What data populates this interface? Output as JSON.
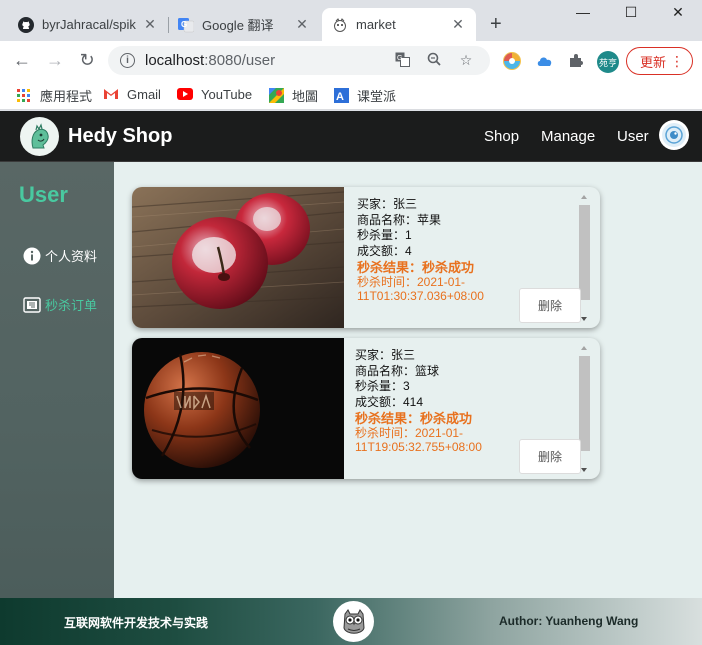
{
  "browser": {
    "tabs": [
      {
        "title": "byrJahracal/spik",
        "icon": "github-icon"
      },
      {
        "title": "Google 翻译",
        "icon": "google-translate-icon"
      },
      {
        "title": "market",
        "icon": "market-favicon-icon"
      }
    ],
    "new_tab": "+",
    "url_host": "localhost",
    "url_path": ":8080/user",
    "update_label": "更新",
    "profile_label": "苑亨",
    "bookmarks": [
      {
        "label": "應用程式",
        "icon": "apps-grid-icon"
      },
      {
        "label": "Gmail",
        "icon": "gmail-icon"
      },
      {
        "label": "YouTube",
        "icon": "youtube-icon"
      },
      {
        "label": "地圖",
        "icon": "maps-icon"
      },
      {
        "label": "课堂派",
        "icon": "ketangpai-icon"
      }
    ]
  },
  "navbar": {
    "brand": "Hedy Shop",
    "links": [
      "Shop",
      "Manage",
      "User"
    ]
  },
  "sidebar": {
    "title": "User",
    "items": [
      {
        "label": "个人资料",
        "icon": "info-icon",
        "color": "#ffffff"
      },
      {
        "label": "秒杀订单",
        "icon": "order-icon",
        "color": "#49c9a0"
      }
    ]
  },
  "orders": [
    {
      "image": "apple-photo",
      "buyer": "买家：张三",
      "product": "商品名称：苹果",
      "quantity": "秒杀量：1",
      "amount": "成交额：4",
      "result": "秒杀结果：秒杀成功",
      "time": "秒杀时间：2021-01-11T01:30:37.036+08:00",
      "delete_label": "删除"
    },
    {
      "image": "basketball-photo",
      "buyer": "买家：张三",
      "product": "商品名称：篮球",
      "quantity": "秒杀量：3",
      "amount": "成交额：414",
      "result": "秒杀结果：秒杀成功",
      "time": "秒杀时间：2021-01-11T19:05:32.755+08:00",
      "delete_label": "删除"
    }
  ],
  "footer": {
    "left": "互联网软件开发技术与实践",
    "right": "Author: Yuanheng Wang"
  },
  "colors": {
    "accent": "#49c9a0",
    "result": "#e8711e",
    "navbar": "#1b1c1c",
    "update": "#d93025"
  }
}
